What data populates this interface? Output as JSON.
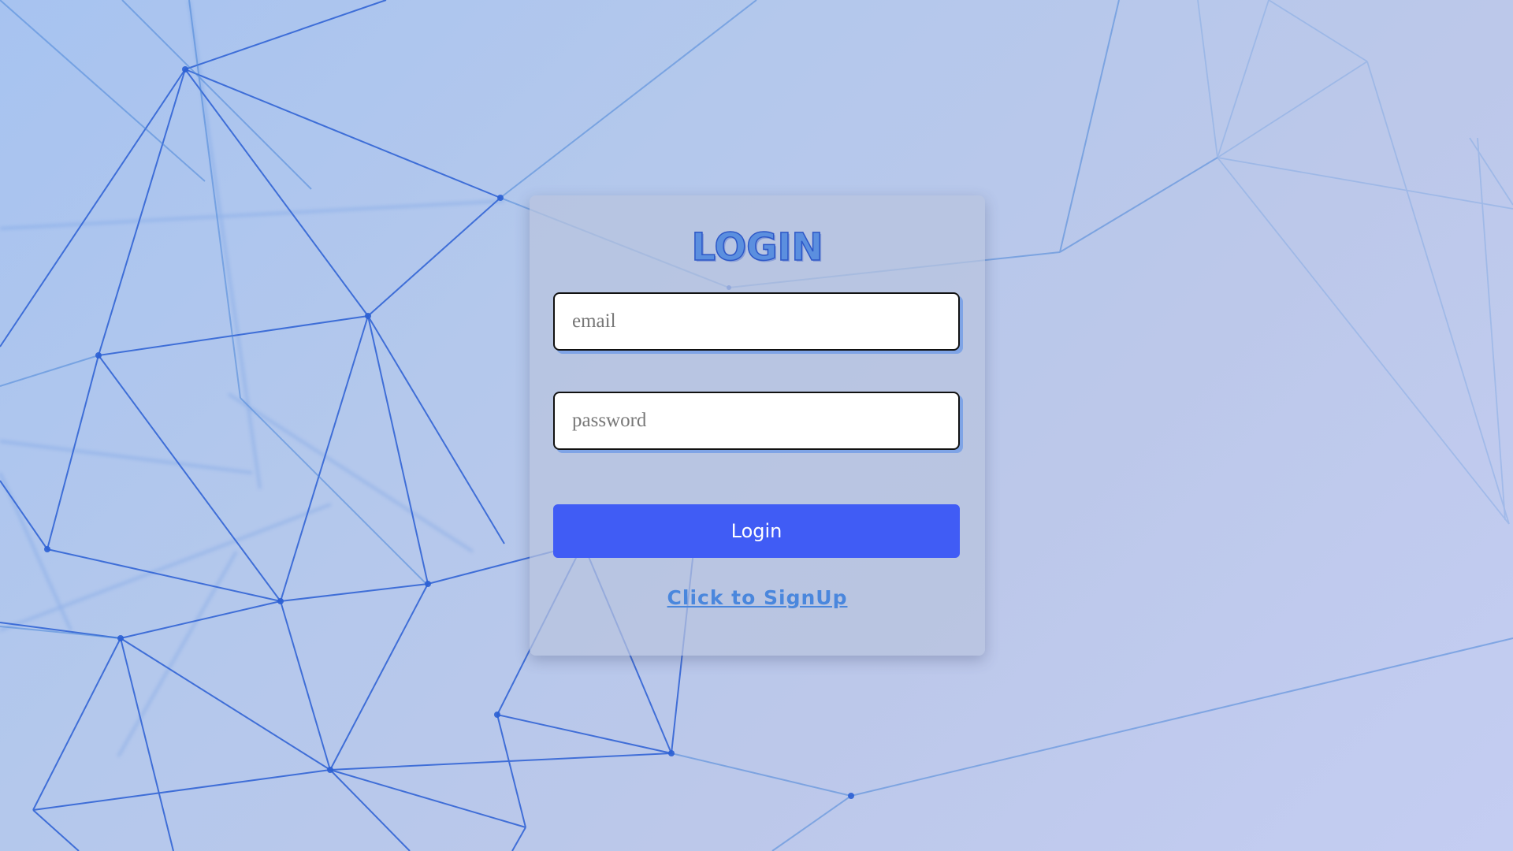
{
  "login_card": {
    "title": "LOGIN",
    "email_placeholder": "email",
    "password_placeholder": "password",
    "login_button_label": "Login",
    "signup_link_label": "Click to SignUp"
  },
  "colors": {
    "button": "#405cf5",
    "title": "#5b8fdf",
    "link": "#4a87dd",
    "mesh_lines": "#2a5fd6"
  }
}
